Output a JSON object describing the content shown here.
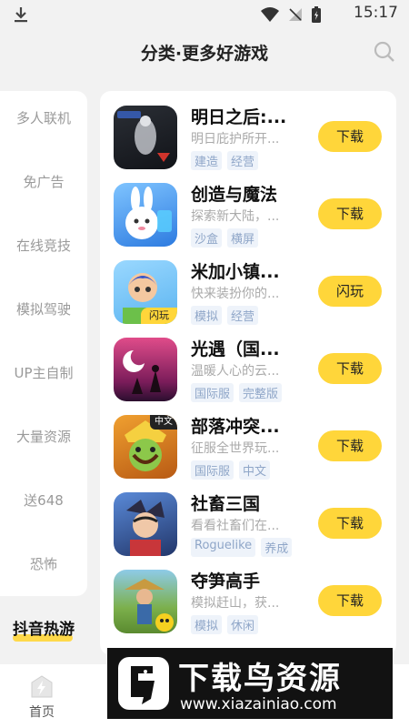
{
  "status_bar": {
    "time": "15:17"
  },
  "header": {
    "title": "分类·更多好游戏"
  },
  "sidebar": {
    "items": [
      "多人联机",
      "免广告",
      "在线竞技",
      "模拟驾驶",
      "UP主自制",
      "大量资源",
      "送648",
      "恐怖"
    ],
    "active": "抖音热游"
  },
  "games": [
    {
      "name": "明日之后:...",
      "desc": "明日庇护所开...",
      "tags": [
        "建造",
        "经营"
      ],
      "button": "下载"
    },
    {
      "name": "创造与魔法",
      "desc": "探索新大陆，...",
      "tags": [
        "沙盒",
        "横屏"
      ],
      "button": "下载"
    },
    {
      "name": "米加小镇...",
      "desc": "快来装扮你的...",
      "tags": [
        "模拟",
        "经营"
      ],
      "button": "闪玩",
      "badge": "闪玩"
    },
    {
      "name": "光遇（国...",
      "desc": "温暖人心的云...",
      "tags": [
        "国际服",
        "完整版"
      ],
      "button": "下载"
    },
    {
      "name": "部落冲突...",
      "desc": "征服全世界玩...",
      "tags": [
        "国际服",
        "中文"
      ],
      "button": "下载",
      "badge": "中文"
    },
    {
      "name": "社畜三国",
      "desc": "看看社畜们在...",
      "tags": [
        "Roguelike",
        "养成"
      ],
      "button": "下载"
    },
    {
      "name": "夺笋高手",
      "desc": "模拟赶山，获...",
      "tags": [
        "模拟",
        "休闲"
      ],
      "button": "下载"
    }
  ],
  "bottom_nav": {
    "home": "首页"
  },
  "watermark": {
    "title": "下载鸟资源",
    "url": "www.xiazainiao.com"
  },
  "colors": {
    "accent": "#ffd63a",
    "background": "#f2f2f2",
    "tag_text": "#8fa6c8"
  },
  "icons": {
    "download": "download-arrow-icon",
    "wifi": "wifi-icon",
    "signal": "no-signal-icon",
    "battery": "battery-charging-icon",
    "search": "search-icon",
    "home": "home-icon"
  }
}
